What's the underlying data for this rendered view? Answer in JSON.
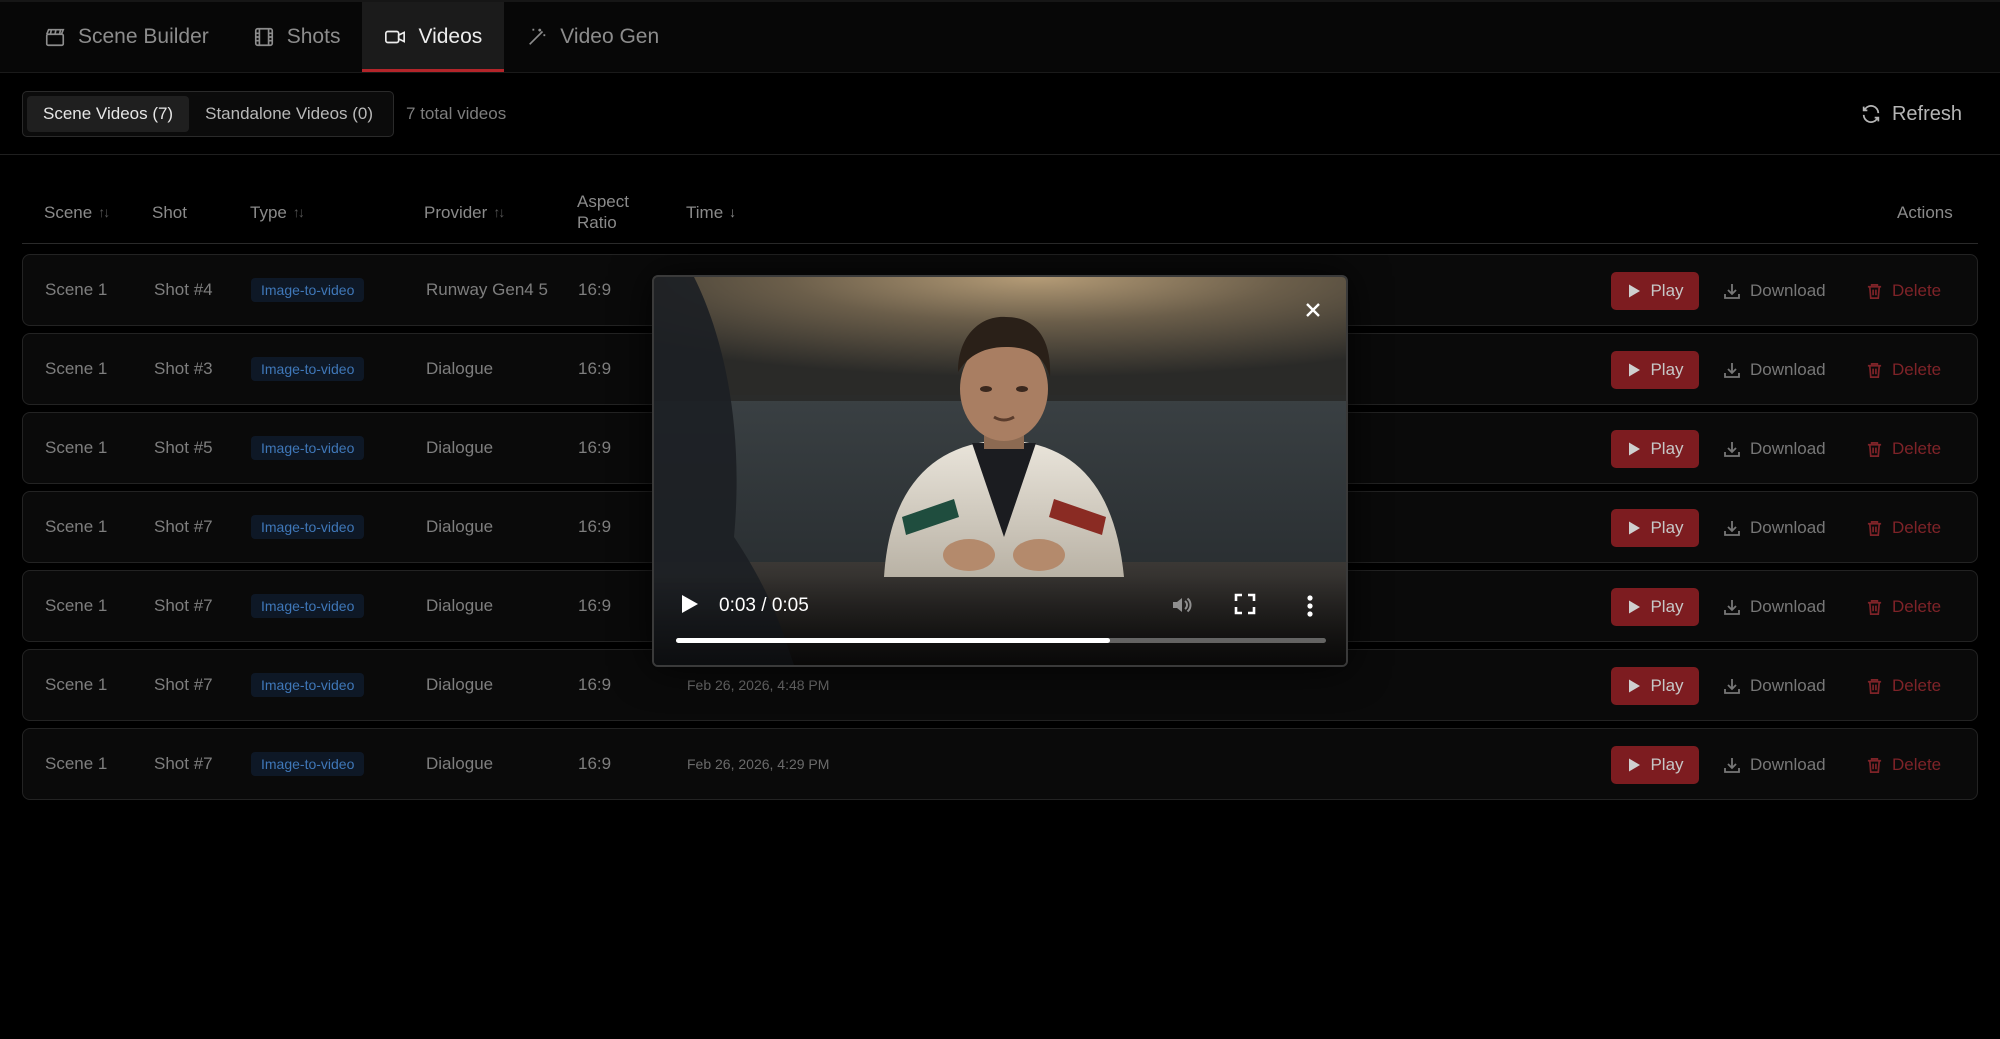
{
  "nav": {
    "tabs": [
      {
        "label": "Scene Builder",
        "icon": "clapperboard-icon"
      },
      {
        "label": "Shots",
        "icon": "film-icon"
      },
      {
        "label": "Videos",
        "icon": "video-icon",
        "active": true
      },
      {
        "label": "Video Gen",
        "icon": "magic-wand-icon"
      }
    ],
    "accent_color": "#b3252a"
  },
  "toolbar": {
    "segments": [
      {
        "label": "Scene Videos (7)",
        "active": true
      },
      {
        "label": "Standalone Videos (0)",
        "active": false
      }
    ],
    "total": "7 total videos",
    "refresh_label": "Refresh"
  },
  "table": {
    "headers": {
      "scene": "Scene",
      "shot": "Shot",
      "type": "Type",
      "provider": "Provider",
      "aspect_line1": "Aspect",
      "aspect_line2": "Ratio",
      "time": "Time",
      "actions": "Actions"
    },
    "action_labels": {
      "play": "Play",
      "download": "Download",
      "delete": "Delete"
    },
    "rows": [
      {
        "scene": "Scene 1",
        "shot": "Shot #4",
        "type": "Image-to-video",
        "provider": "Runway Gen4 5",
        "aspect": "16:9",
        "time": ""
      },
      {
        "scene": "Scene 1",
        "shot": "Shot #3",
        "type": "Image-to-video",
        "provider": "Dialogue",
        "aspect": "16:9",
        "time": ""
      },
      {
        "scene": "Scene 1",
        "shot": "Shot #5",
        "type": "Image-to-video",
        "provider": "Dialogue",
        "aspect": "16:9",
        "time": ""
      },
      {
        "scene": "Scene 1",
        "shot": "Shot #7",
        "type": "Image-to-video",
        "provider": "Dialogue",
        "aspect": "16:9",
        "time": ""
      },
      {
        "scene": "Scene 1",
        "shot": "Shot #7",
        "type": "Image-to-video",
        "provider": "Dialogue",
        "aspect": "16:9",
        "time": ""
      },
      {
        "scene": "Scene 1",
        "shot": "Shot #7",
        "type": "Image-to-video",
        "provider": "Dialogue",
        "aspect": "16:9",
        "time": "Feb 26, 2026, 4:48 PM"
      },
      {
        "scene": "Scene 1",
        "shot": "Shot #7",
        "type": "Image-to-video",
        "provider": "Dialogue",
        "aspect": "16:9",
        "time": "Feb 26, 2026, 4:29 PM"
      }
    ]
  },
  "player": {
    "time_display": "0:03 / 0:05",
    "progress_fraction": 0.667
  }
}
